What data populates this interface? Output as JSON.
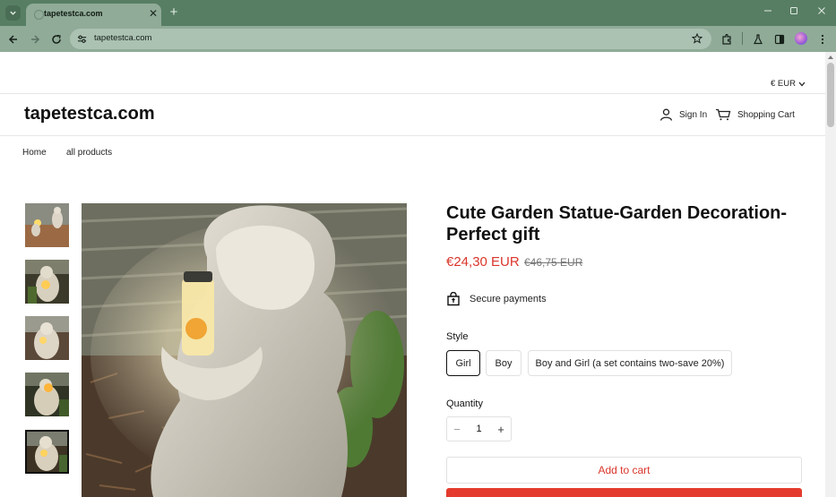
{
  "browser": {
    "tab_title": "tapetestca.com",
    "url": "tapetestca.com",
    "icons": [
      "tab-search-icon",
      "close-icon",
      "plus-icon",
      "minimize-icon",
      "maximize-icon",
      "close-window-icon",
      "back-icon",
      "forward-icon",
      "reload-icon",
      "site-info-icon",
      "star-icon",
      "extensions-icon",
      "labs-icon",
      "side-panel-icon",
      "profile-avatar",
      "kebab-menu-icon"
    ]
  },
  "store": {
    "currency": "€ EUR",
    "logo": "tapetestca.com",
    "sign_in": "Sign In",
    "cart": "Shopping Cart",
    "nav": [
      "Home",
      "all products"
    ]
  },
  "product": {
    "title": "Cute Garden Statue-Garden Decoration-Perfect gift",
    "price": "€24,30 EUR",
    "compare_price": "€46,75 EUR",
    "secure": "Secure payments",
    "style_label": "Style",
    "styles": [
      "Girl",
      "Boy",
      "Boy and Girl (a set contains two-save 20%)"
    ],
    "selected_style": "Girl",
    "quantity_label": "Quantity",
    "quantity": "1",
    "add_to_cart": "Add to cart",
    "thumbnail_count": 5,
    "active_thumbnail": 5
  },
  "colors": {
    "chrome_dark": "#577e63",
    "chrome_light": "#90ab98",
    "accent_red": "#d9362b",
    "buy_button": "#e43b2e"
  }
}
